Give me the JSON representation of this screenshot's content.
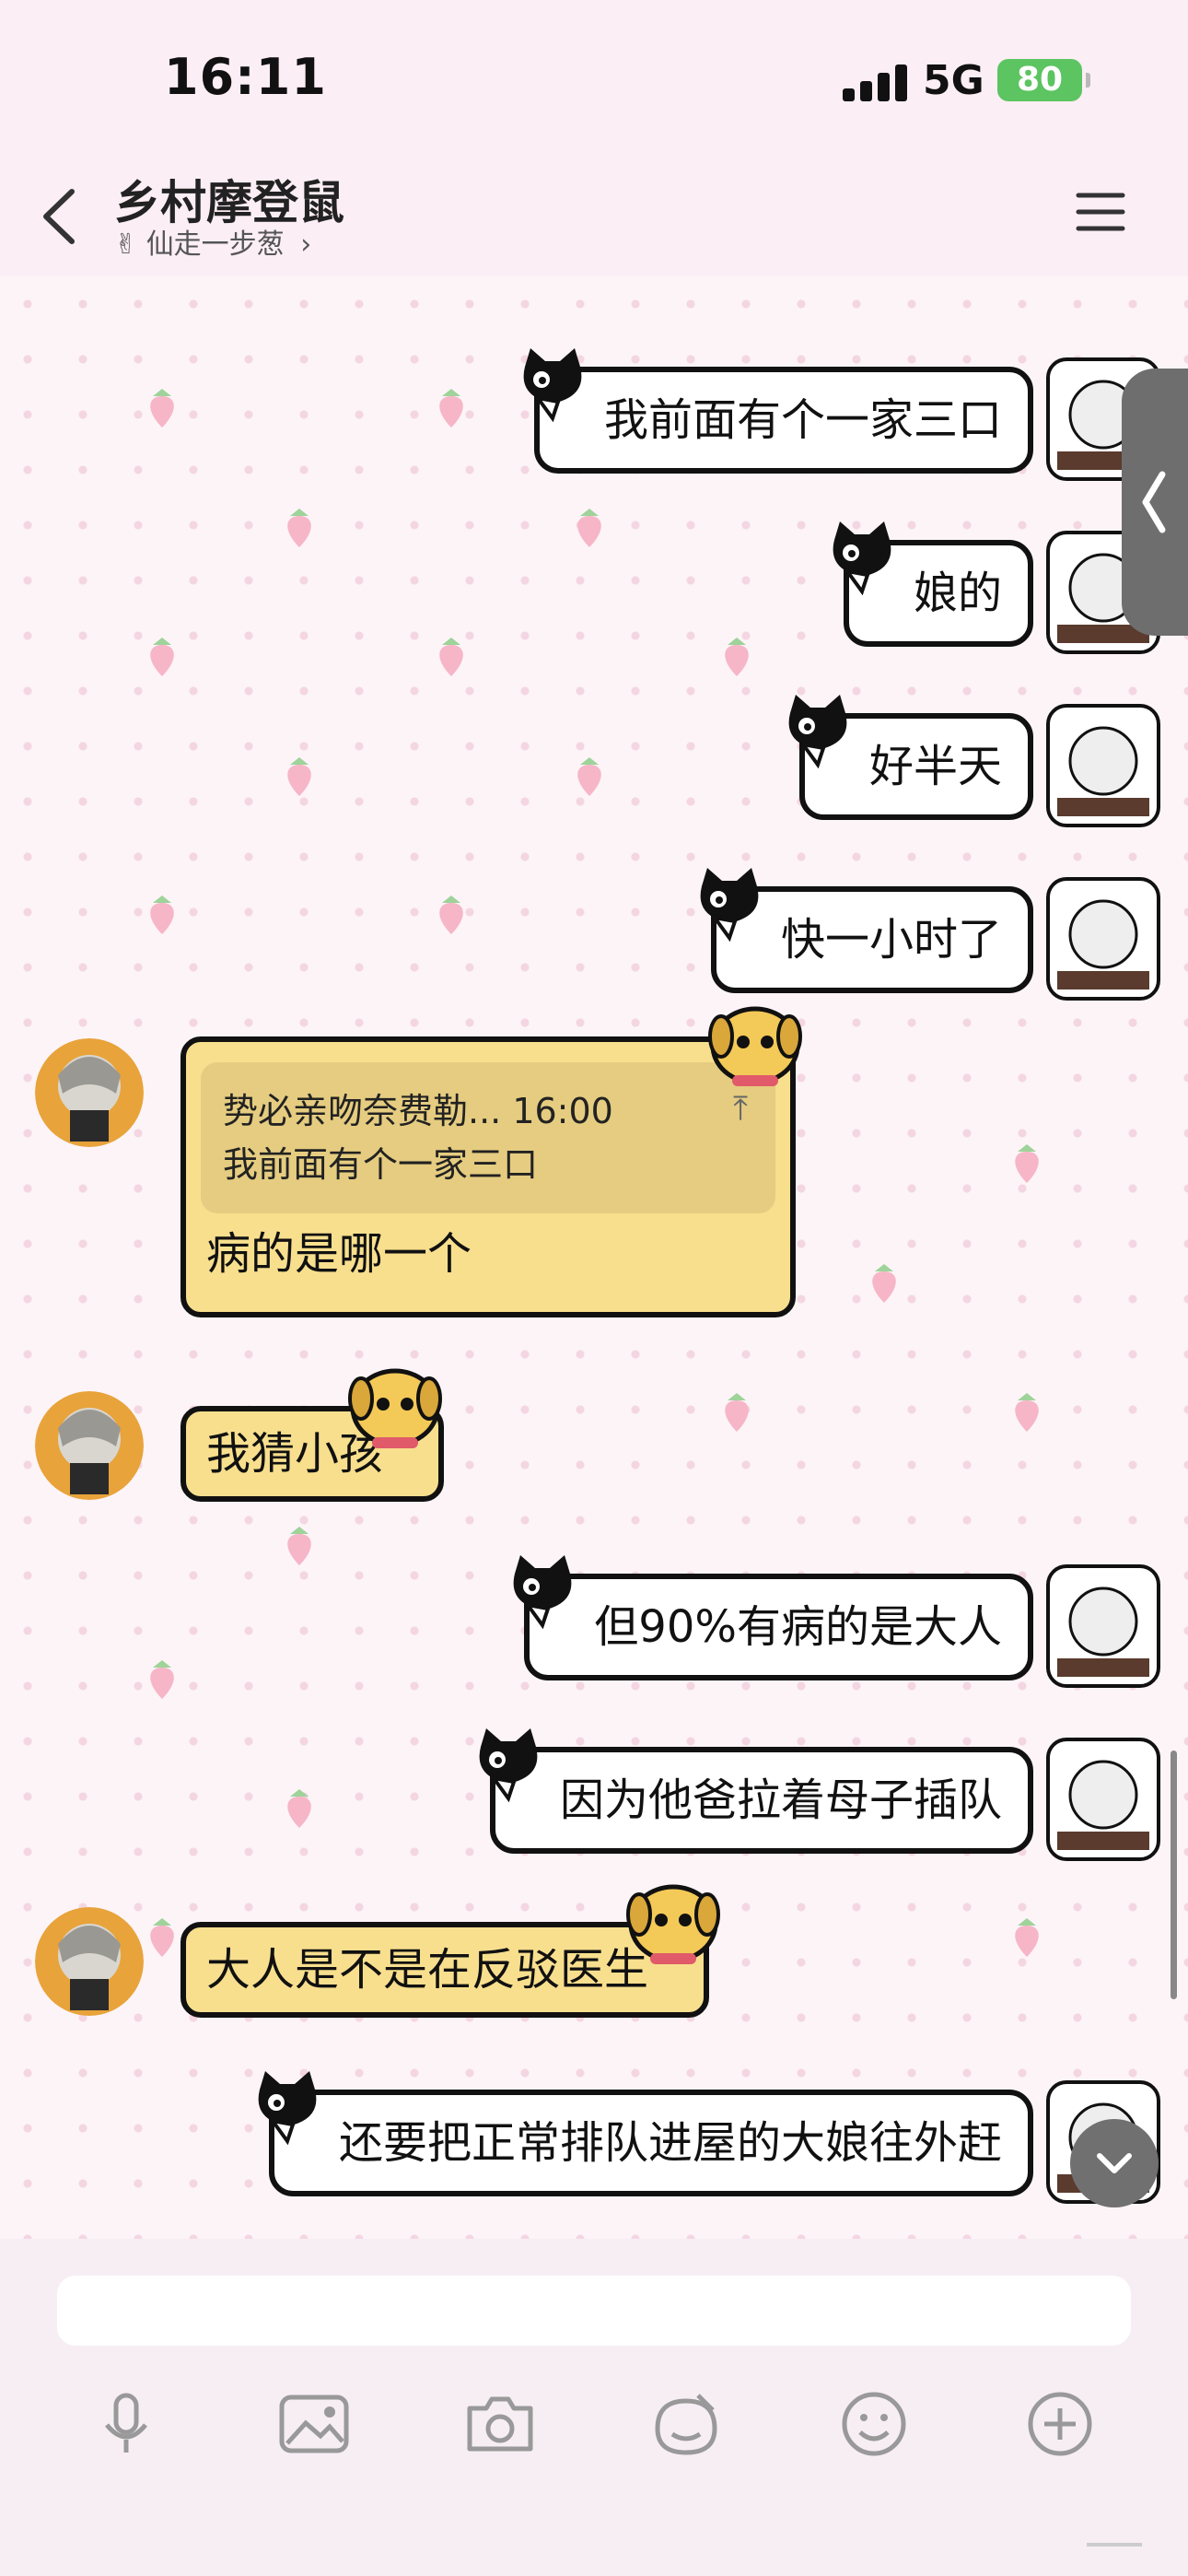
{
  "status": {
    "time": "16:11",
    "network": "5G",
    "battery": "80"
  },
  "header": {
    "title": "乡村摩登鼠",
    "subtitle_emoji": "✌",
    "subtitle": "仙走一步葱"
  },
  "messages": [
    {
      "side": "out",
      "text": "我前面有个一家三口"
    },
    {
      "side": "out",
      "text": "娘的"
    },
    {
      "side": "out",
      "text": "好半天"
    },
    {
      "side": "out",
      "text": "快一小时了"
    },
    {
      "side": "in",
      "quote": {
        "author_time": "势必亲吻奈费勒... 16:00",
        "text": "我前面有个一家三口"
      },
      "text": "病的是哪一个"
    },
    {
      "side": "in",
      "text": "我猜小孩"
    },
    {
      "side": "out",
      "text": "但90%有病的是大人"
    },
    {
      "side": "out",
      "text": "因为他爸拉着母子插队"
    },
    {
      "side": "in",
      "text": "大人是不是在反驳医生"
    },
    {
      "side": "out",
      "text": "还要把正常排队进屋的大娘往外赶"
    }
  ],
  "input": {
    "placeholder": ""
  },
  "toolbar": [
    "mic-icon",
    "image-icon",
    "camera-icon",
    "sticker-pen-icon",
    "emoji-icon",
    "plus-icon"
  ],
  "colors": {
    "incoming_bubble": "#f8df8e",
    "outgoing_bubble": "#ffffff",
    "background": "#fbeef4",
    "battery": "#5cc461"
  }
}
